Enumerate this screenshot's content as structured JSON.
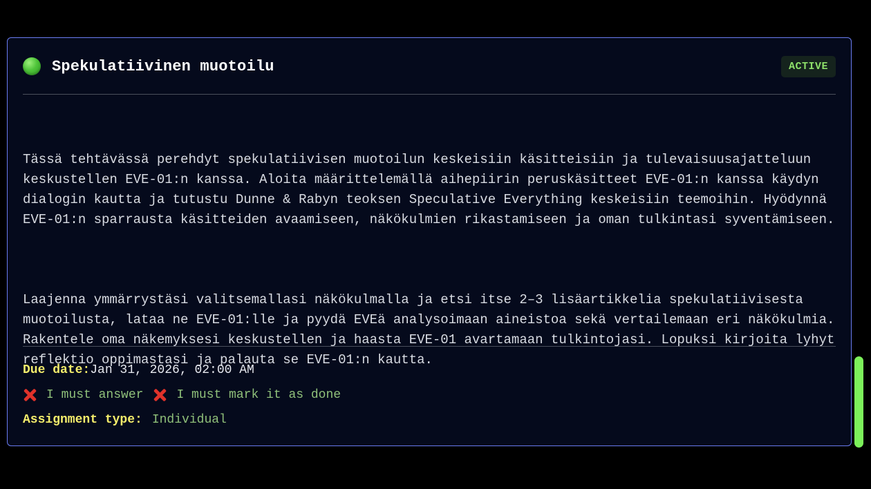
{
  "assignment": {
    "status_icon": "green-circle",
    "title": "Spekulatiivinen muotoilu",
    "badge": "ACTIVE",
    "description": [
      "Tässä tehtävässä perehdyt spekulatiivisen muotoilun keskeisiin käsitteisiin ja tulevaisuusajatteluun keskustellen EVE-01:n kanssa. Aloita määrittelemällä aihepiirin peruskäsitteet EVE-01:n kanssa käydyn dialogin kautta ja tutustu Dunne & Rabyn teoksen Speculative Everything keskeisiin teemoihin. Hyödynnä EVE-01:n sparrausta käsitteiden avaamiseen, näkökulmien rikastamiseen ja oman tulkintasi syventämiseen.",
      "Laajenna ymmärrystäsi valitsemallasi näkökulmalla ja etsi itse 2–3 lisäartikkelia spekulatiivisesta muotoilusta, lataa ne EVE-01:lle ja pyydä EVEä analysoimaan aineistoa sekä vertailemaan eri näkökulmia. Rakentele oma näkemyksesi keskustellen ja haasta EVE-01 avartamaan tulkintojasi. Lopuksi kirjoita lyhyt reflektio oppimastasi ja palauta se EVE-01:n kautta."
    ],
    "due_label": "Due date:",
    "due_value": "Jan 31, 2026, 02:00 AM",
    "requirements": [
      {
        "icon": "cross-mark-icon",
        "text": "I must answer"
      },
      {
        "icon": "cross-mark-icon",
        "text": "I must mark it as done"
      }
    ],
    "type_label": "Assignment type:",
    "type_value": "Individual"
  },
  "colors": {
    "background": "#000000",
    "card_background": "#050a1c",
    "card_border": "#6a7cf0",
    "badge_text": "#8ee06a",
    "label": "#f3ec6b",
    "requirement_text": "#8fc07a",
    "cross": "#e0322a",
    "scrollbar": "#7cf05a"
  }
}
